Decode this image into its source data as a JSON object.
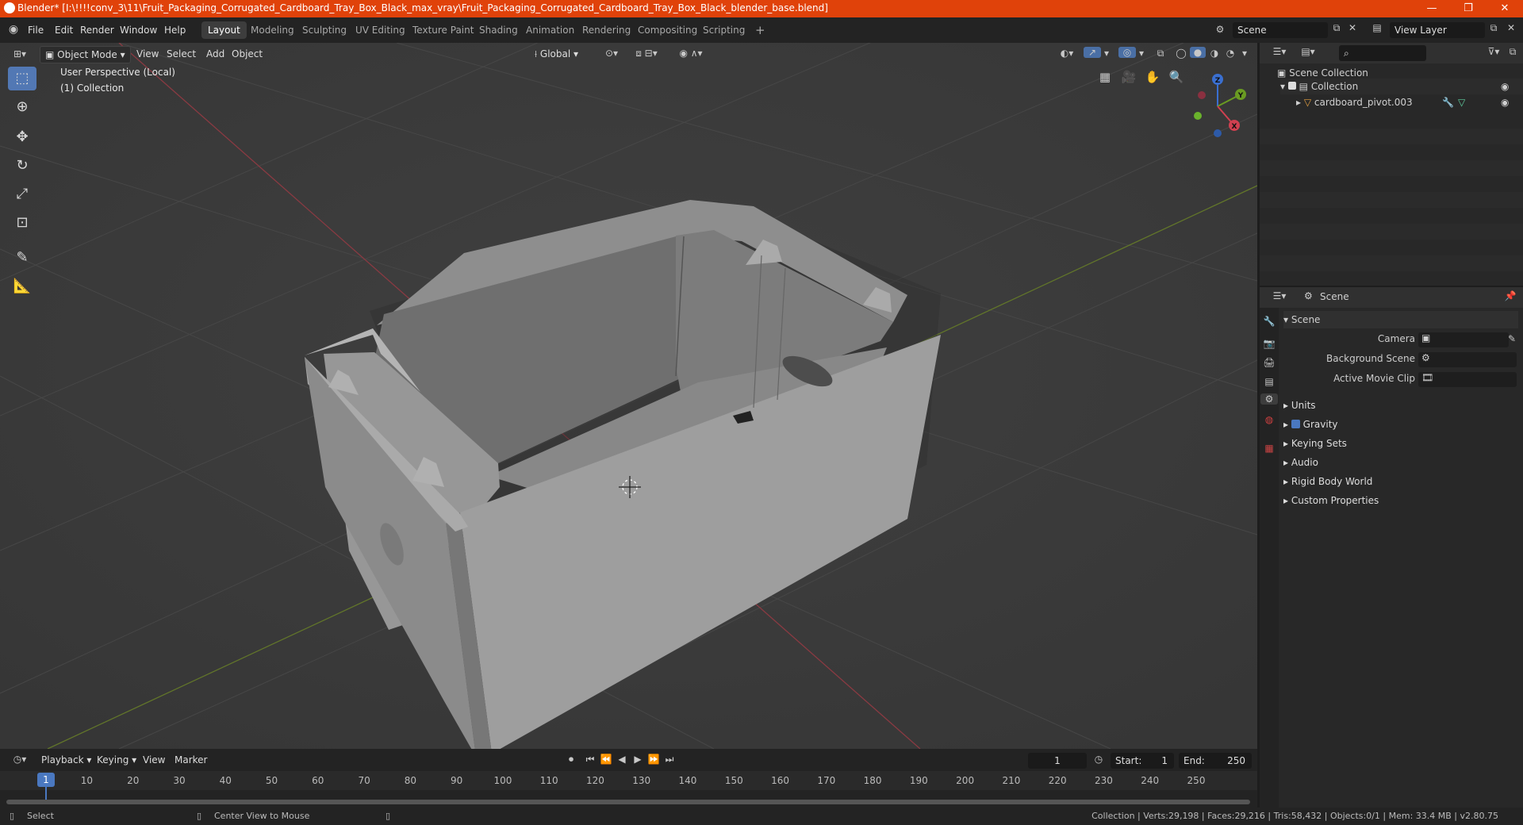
{
  "window": {
    "title": "Blender* [I:\\!!!!conv_3\\11\\Fruit_Packaging_Corrugated_Cardboard_Tray_Box_Black_max_vray\\Fruit_Packaging_Corrugated_Cardboard_Tray_Box_Black_blender_base.blend]",
    "minimize": "—",
    "maximize": "❐",
    "close": "✕"
  },
  "menu": [
    "File",
    "Edit",
    "Render",
    "Window",
    "Help"
  ],
  "workspaces": [
    "Layout",
    "Modeling",
    "Sculpting",
    "UV Editing",
    "Texture Paint",
    "Shading",
    "Animation",
    "Rendering",
    "Compositing",
    "Scripting"
  ],
  "active_workspace": "Layout",
  "add_workspace": "+",
  "scene_selector": "Scene",
  "view_layer": "View Layer",
  "viewport": {
    "mode": "Object Mode",
    "menus": [
      "View",
      "Select",
      "Add",
      "Object"
    ],
    "transform_orientation": "Global",
    "overlay_line1": "User Perspective (Local)",
    "overlay_line2": "(1) Collection",
    "gizmo": {
      "x": "X",
      "y": "Y",
      "z": "Z"
    }
  },
  "outliner": {
    "root": "Scene Collection",
    "collection": "Collection",
    "object": "cardboard_pivot.003"
  },
  "properties": {
    "header": "Scene",
    "panel_title": "Scene",
    "camera_label": "Camera",
    "background_scene_label": "Background Scene",
    "active_movie_clip_label": "Active Movie Clip",
    "sections": [
      "Units",
      "Gravity",
      "Keying Sets",
      "Audio",
      "Rigid Body World",
      "Custom Properties"
    ]
  },
  "timeline": {
    "menus": [
      "Playback",
      "Keying",
      "View",
      "Marker"
    ],
    "current_frame": "1",
    "start_label": "Start:",
    "start": "1",
    "end_label": "End:",
    "end": "250",
    "ticks": [
      "1",
      "10",
      "20",
      "30",
      "40",
      "50",
      "60",
      "70",
      "80",
      "90",
      "100",
      "110",
      "120",
      "130",
      "140",
      "150",
      "160",
      "170",
      "180",
      "190",
      "200",
      "210",
      "220",
      "230",
      "240",
      "250"
    ]
  },
  "status": {
    "select": "Select",
    "center": "Center View to Mouse",
    "stats": "Collection | Verts:29,198 | Faces:29,216 | Tris:58,432 | Objects:0/1 | Mem: 33.4 MB | v2.80.75"
  }
}
